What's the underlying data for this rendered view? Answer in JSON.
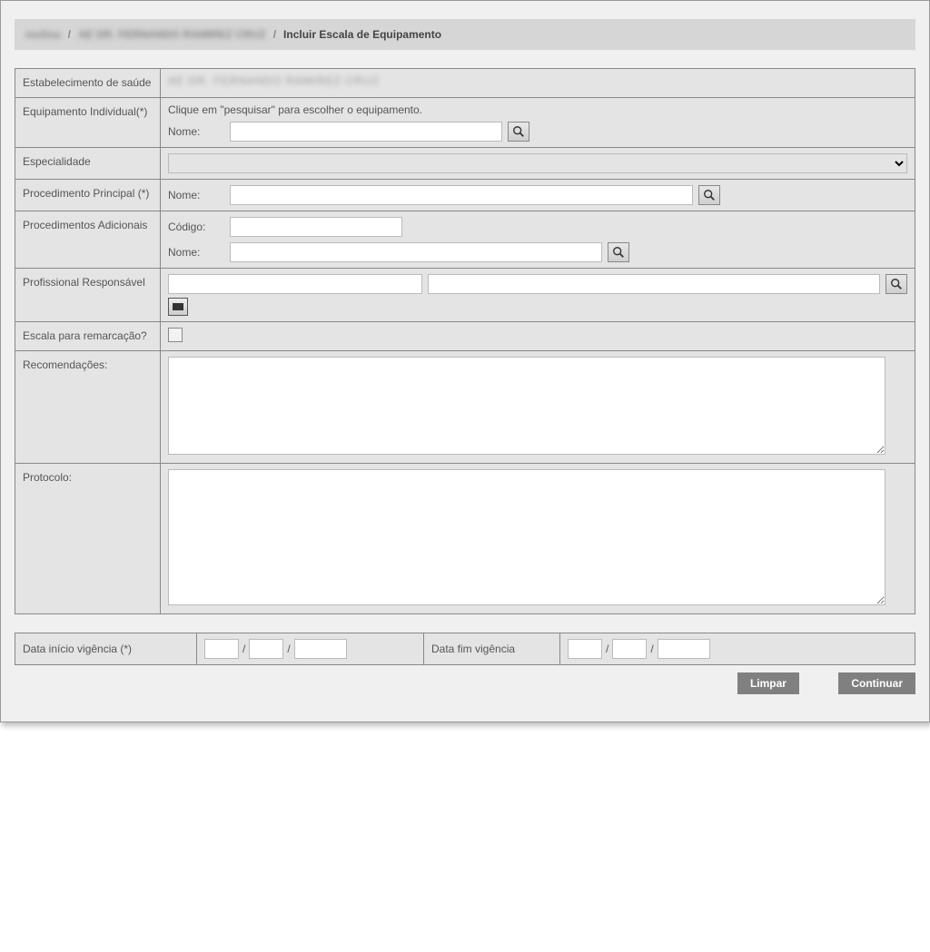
{
  "breadcrumb": {
    "item1": "molina",
    "item2": "AE DR. FERNANDO RAMIREZ CRUZ",
    "current": "Incluir Escala de Equipamento"
  },
  "labels": {
    "estabelecimento": "Estabelecimento de saúde",
    "equipamento": "Equipamento Individual(*)",
    "especialidade": "Especialidade",
    "procedimento_principal": "Procedimento Principal (*)",
    "procedimentos_adicionais": "Procedimentos Adicionais",
    "profissional": "Profissional Responsável",
    "escala_remarcacao": "Escala para remarcação?",
    "recomendacoes": "Recomendações:",
    "protocolo": "Protocolo:",
    "data_inicio": "Data início vigência (*)",
    "data_fim": "Data fim vigência"
  },
  "sublabels": {
    "nome": "Nome:",
    "codigo": "Código:"
  },
  "values": {
    "estabelecimento": "AE DR. FERNANDO RAMIREZ CRUZ",
    "equip_hint": "Clique em \"pesquisar\" para escolher o equipamento.",
    "equip_nome": "",
    "especialidade": "",
    "proc_principal_nome": "",
    "proc_adic_codigo": "",
    "proc_adic_nome": "",
    "profissional_a": "",
    "profissional_b": "",
    "escala_remarcacao": false,
    "recomendacoes": "",
    "protocolo": "",
    "date_slash": "/",
    "data_inicio_d": "",
    "data_inicio_m": "",
    "data_inicio_y": "",
    "data_fim_d": "",
    "data_fim_m": "",
    "data_fim_y": ""
  },
  "buttons": {
    "limpar": "Limpar",
    "continuar": "Continuar"
  }
}
